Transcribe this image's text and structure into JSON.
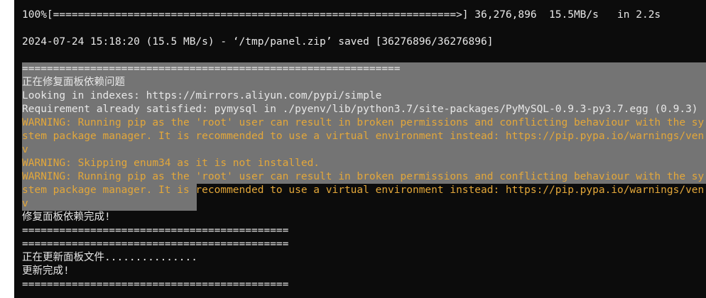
{
  "terminal": {
    "lines": [
      {
        "text": "100%[=================================================================>] 36,276,896  15.5MB/s   in 2.2s",
        "type": "normal"
      },
      {
        "text": "",
        "type": "normal"
      },
      {
        "text": "2024-07-24 15:18:20 (15.5 MB/s) - ‘/tmp/panel.zip’ saved [36276896/36276896]",
        "type": "normal"
      },
      {
        "text": "",
        "type": "normal"
      },
      {
        "text": "=============================================================",
        "type": "normal"
      },
      {
        "text": "正在修复面板依赖问题",
        "type": "normal"
      },
      {
        "text": "Looking in indexes: https://mirrors.aliyun.com/pypi/simple",
        "type": "normal"
      },
      {
        "text": "Requirement already satisfied: pymysql in ./pyenv/lib/python3.7/site-packages/PyMySQL-0.9.3-py3.7.egg (0.9.3)",
        "type": "normal"
      },
      {
        "text": "WARNING: Running pip as the 'root' user can result in broken permissions and conflicting behaviour with the sy",
        "type": "warn"
      },
      {
        "text": "stem package manager. It is recommended to use a virtual environment instead: https://pip.pypa.io/warnings/ven",
        "type": "warn"
      },
      {
        "text": "v",
        "type": "warn"
      },
      {
        "text": "WARNING: Skipping enum34 as it is not installed.",
        "type": "warn"
      },
      {
        "text": "WARNING: Running pip as the 'root' user can result in broken permissions and conflicting behaviour with the sy",
        "type": "warn"
      },
      {
        "text": "stem package manager. It is recommended to use a virtual environment instead: https://pip.pypa.io/warnings/ven",
        "type": "warn"
      },
      {
        "text": "v",
        "type": "warn"
      },
      {
        "text": "修复面板依赖完成!",
        "type": "normal"
      },
      {
        "text": "===========================================",
        "type": "normal"
      },
      {
        "text": "===========================================",
        "type": "normal"
      },
      {
        "text": "正在更新面板文件...............",
        "type": "normal"
      },
      {
        "text": "更新完成!",
        "type": "normal"
      },
      {
        "text": "===========================================",
        "type": "normal"
      }
    ]
  },
  "colors": {
    "background": "#0c0c0c",
    "text": "#e8e8e8",
    "warning": "#e3a73a",
    "selection": "#7a7a7a"
  }
}
